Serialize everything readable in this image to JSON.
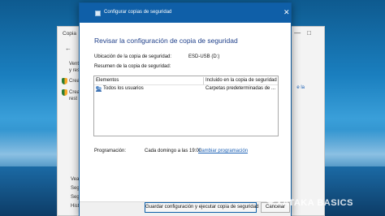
{
  "background_window": {
    "title": "Copia",
    "back_arrow": "←",
    "window_controls": "—□",
    "search_text": "control",
    "side_items": [
      "Vent",
      "y res",
      "Crea",
      "Crea",
      "rest"
    ],
    "link_text": "e la",
    "bottom_items": [
      "Vea",
      "Segu",
      "Segu",
      "Hist"
    ]
  },
  "dialog": {
    "title": "Configurar copias de seguridad",
    "close_glyph": "✕",
    "heading": "Revisar la configuración de copia de seguridad",
    "location_label": "Ubicación de la copia de seguridad:",
    "location_value": "ESD-USB (D:)",
    "summary_label": "Resumen de la copia de seguridad:",
    "table": {
      "columns": [
        "Elementos",
        "Incluido en la copia de seguridad"
      ],
      "rows": [
        {
          "item": "Todos los usuarios",
          "included": "Carpetas predeterminadas de ..."
        }
      ]
    },
    "schedule_label": "Programación:",
    "schedule_value": "Cada domingo a las 19:00",
    "change_schedule_link": "Cambiar programación",
    "save_button": "Guardar configuración y ejecutar copia de seguridad",
    "cancel_button": "Cancelar"
  },
  "watermark": "XATAKA BASICS"
}
